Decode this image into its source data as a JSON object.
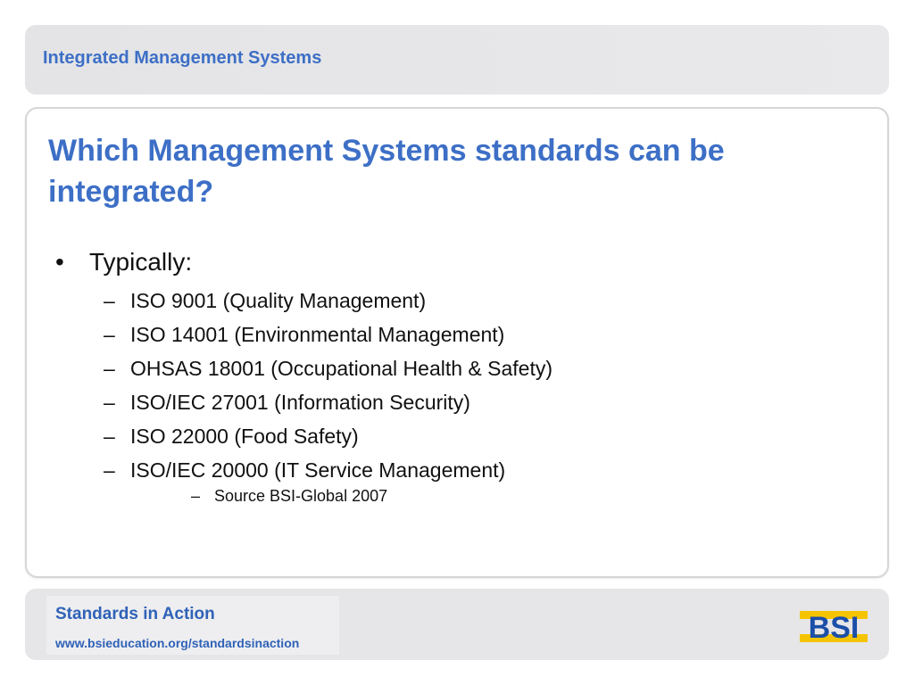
{
  "header": {
    "title": "Integrated Management Systems"
  },
  "content": {
    "question": "Which Management Systems standards can be integrated?",
    "bullet_mark": "•",
    "bullet": "Typically:",
    "dash": "–",
    "items": [
      "ISO 9001 (Quality Management)",
      "ISO 14001 (Environmental Management)",
      "OHSAS 18001 (Occupational Health & Safety)",
      "ISO/IEC 27001 (Information Security)",
      "ISO 22000 (Food Safety)",
      "ISO/IEC 20000 (IT Service Management)"
    ],
    "source": "Source BSI-Global 2007"
  },
  "footer": {
    "title": "Standards in Action",
    "url": "www.bsieducation.org/standardsinaction"
  },
  "logo": {
    "text": "BSI",
    "icon": "bsi-logo",
    "colors": {
      "blue": "#1b4fa8",
      "yellow": "#f5c400"
    }
  },
  "colors": {
    "accent": "#3d6fc6",
    "footer_text": "#2f62b7",
    "panel_gray": "#e6e6e8"
  }
}
